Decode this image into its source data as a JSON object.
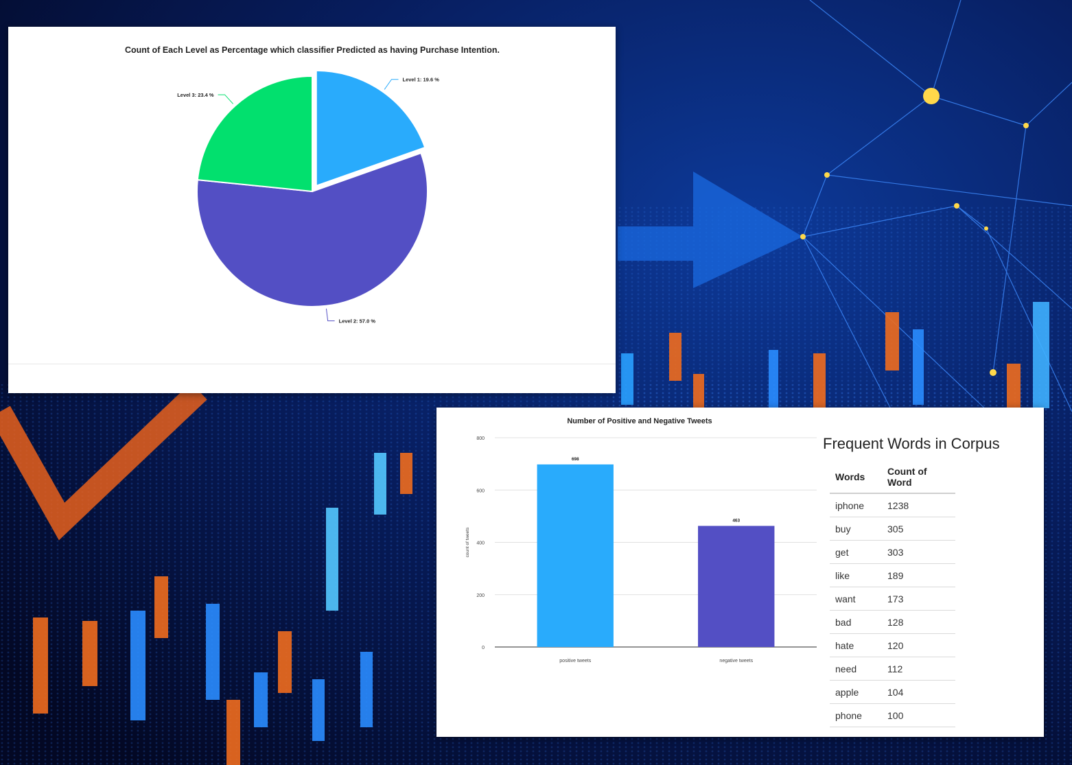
{
  "colors": {
    "level1": "#29abfc",
    "level2": "#534fc4",
    "level3": "#02e06e",
    "positive": "#29abfc",
    "negative": "#534fc4",
    "background": "#040b2c",
    "accent_blue": "#1f6fe0",
    "accent_orange": "#ef6c1e"
  },
  "chart_data": [
    {
      "type": "pie",
      "title": "Count of Each Level as Percentage which classifier Predicted as having Purchase Intention.",
      "slices": [
        {
          "name": "Level 1",
          "value": 19.6,
          "label": "Level 1: 19.6 %"
        },
        {
          "name": "Level 2",
          "value": 57.0,
          "label": "Level 2: 57.0 %"
        },
        {
          "name": "Level 3",
          "value": 23.4,
          "label": "Level 3: 23.4 %"
        }
      ],
      "exploded": [
        "Level 1"
      ]
    },
    {
      "type": "bar",
      "title": "Number of Positive and Negative Tweets",
      "categories": [
        "positive tweets",
        "negative tweets"
      ],
      "values": [
        698,
        463
      ],
      "value_labels": [
        "698",
        "463"
      ],
      "ylabel": "count of tweets",
      "xlabel": "",
      "ylim": [
        0,
        800
      ],
      "yticks": [
        0,
        200,
        400,
        600,
        800
      ],
      "grid": true
    },
    {
      "type": "table",
      "title": "Frequent Words in Corpus",
      "columns": [
        "Words",
        "Count of Word"
      ],
      "rows": [
        [
          "iphone",
          "1238"
        ],
        [
          "buy",
          "305"
        ],
        [
          "get",
          "303"
        ],
        [
          "like",
          "189"
        ],
        [
          "want",
          "173"
        ],
        [
          "bad",
          "128"
        ],
        [
          "hate",
          "120"
        ],
        [
          "need",
          "112"
        ],
        [
          "apple",
          "104"
        ],
        [
          "phone",
          "100"
        ]
      ]
    }
  ]
}
